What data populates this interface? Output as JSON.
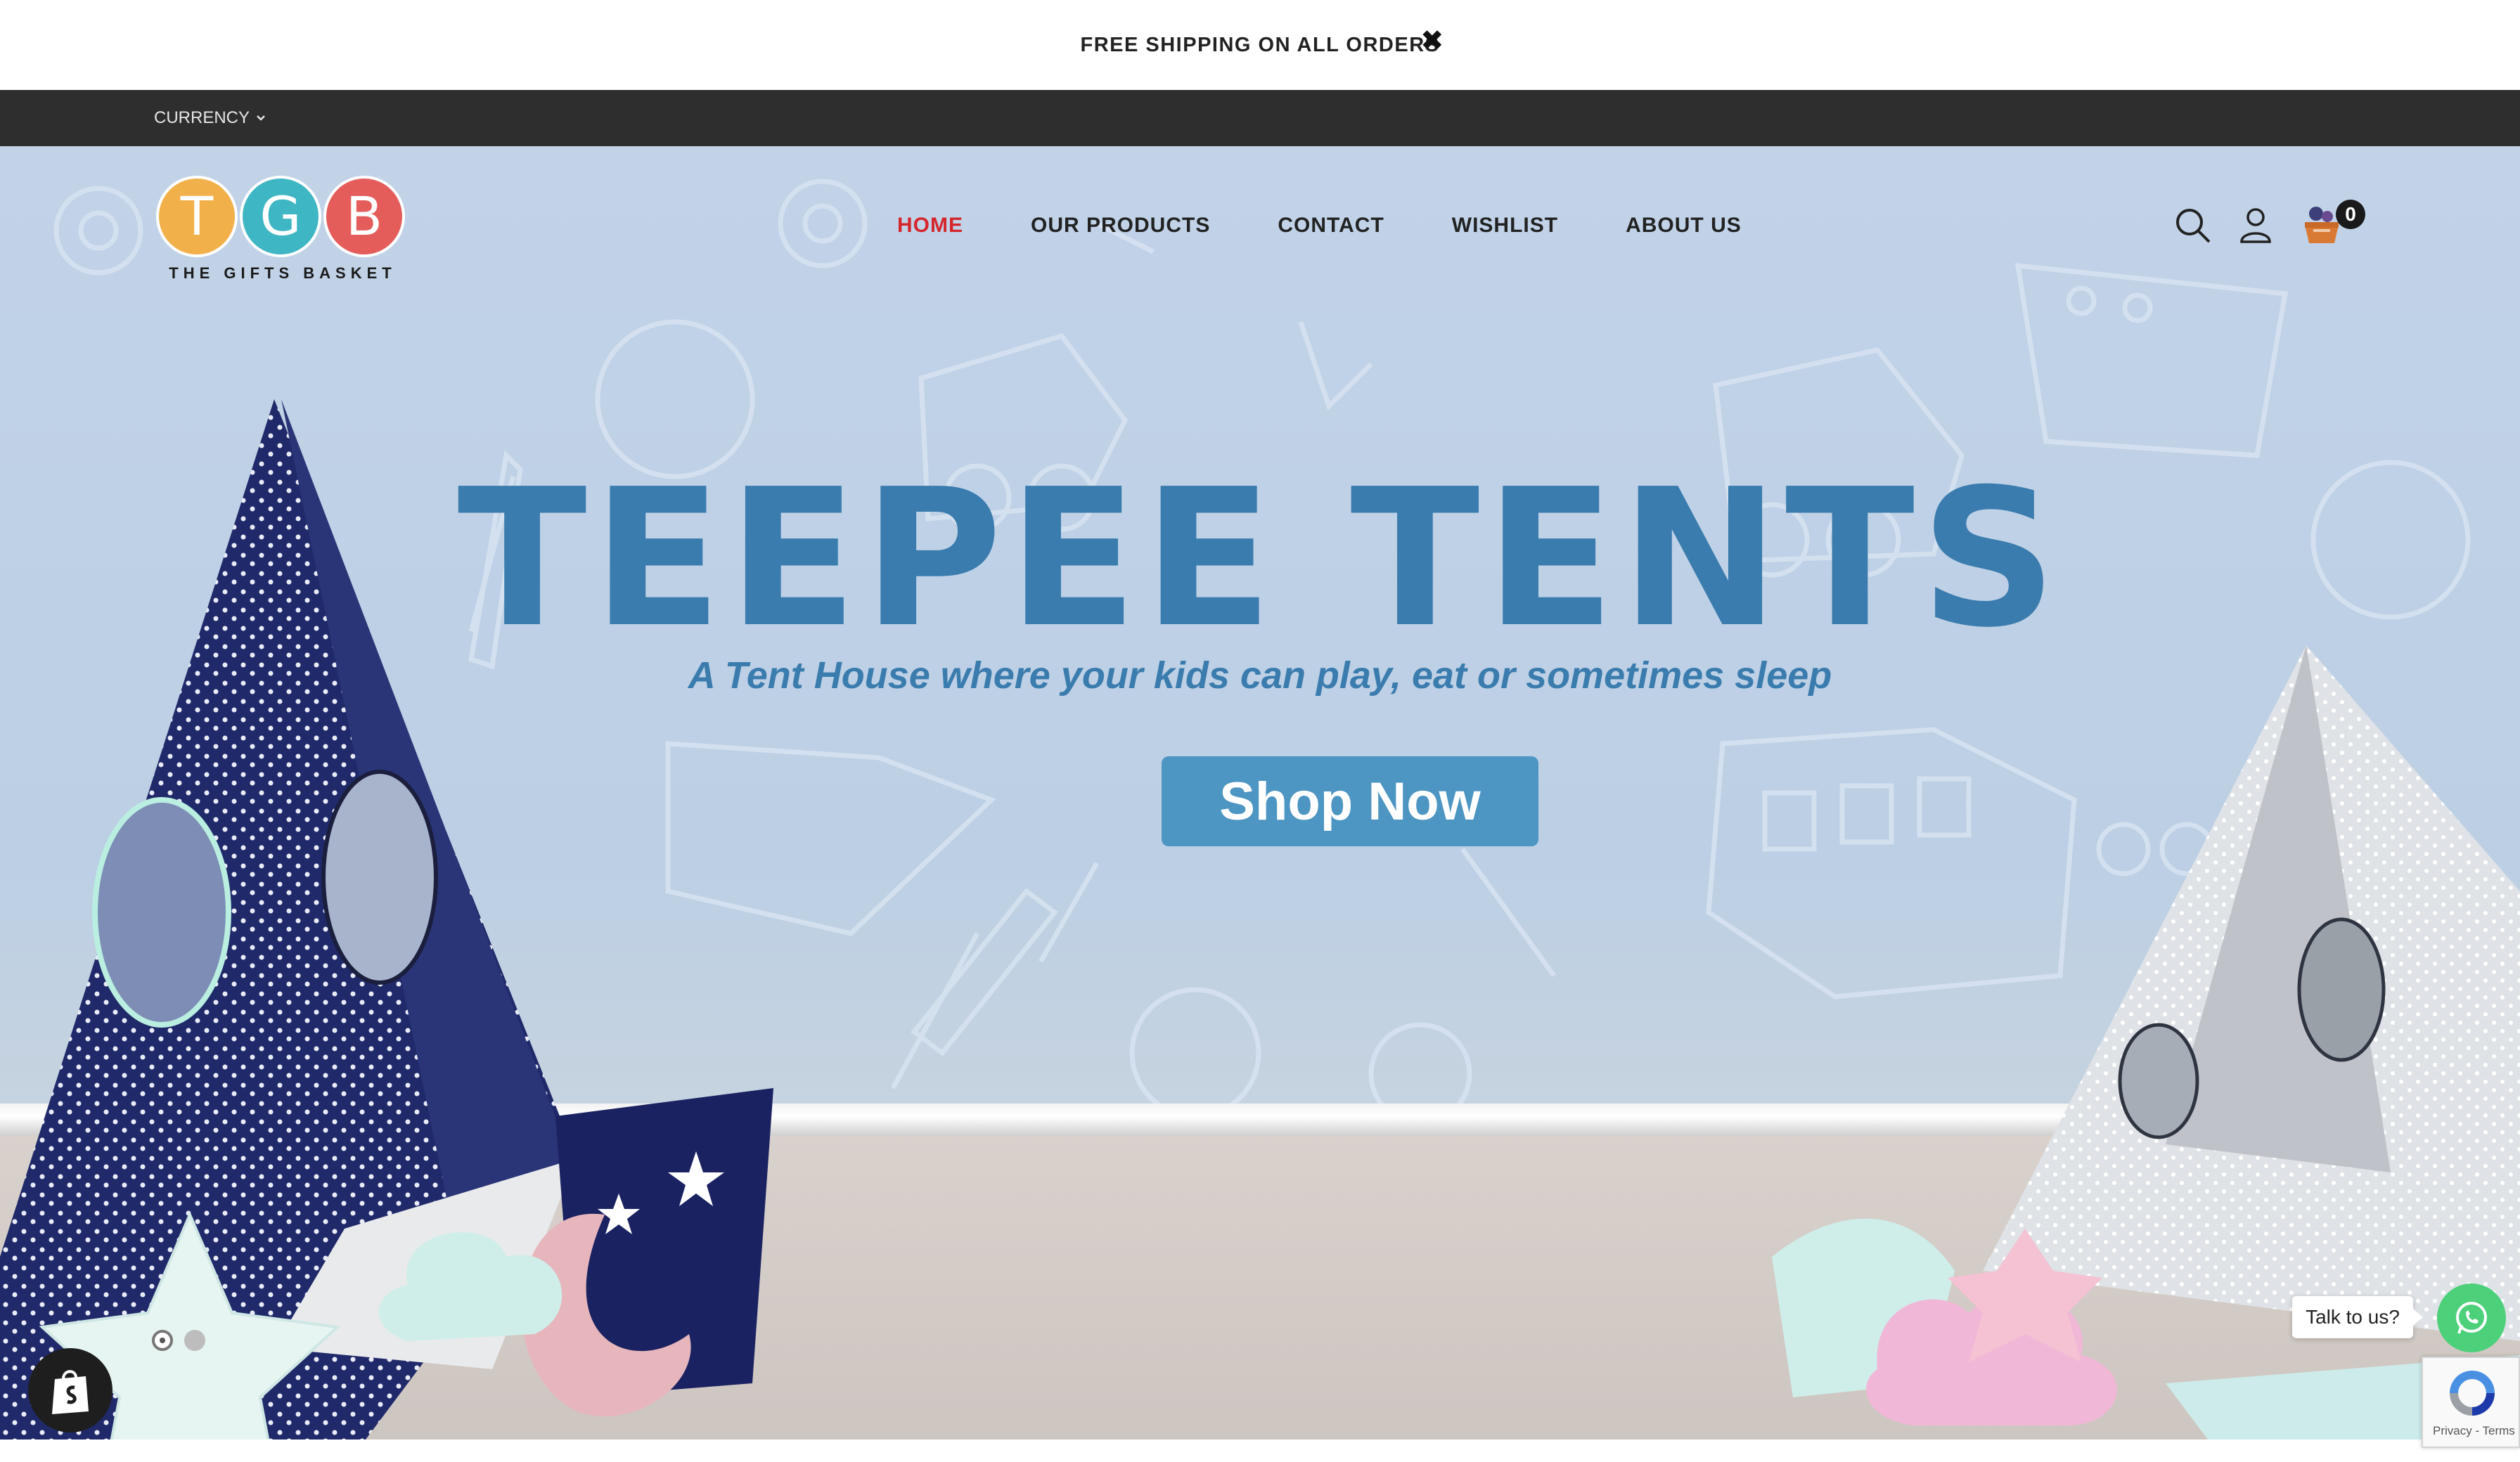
{
  "announcement": {
    "text": "FREE SHIPPING ON ALL ORDERS",
    "close_glyph": "✖"
  },
  "topbar": {
    "currency_label": "CURRENCY"
  },
  "logo": {
    "letters": [
      "T",
      "G",
      "B"
    ],
    "tagline": "THE GIFTS BASKET",
    "letter_colors": [
      "#f2b04a",
      "#3fb6c4",
      "#e45d5b"
    ]
  },
  "nav": {
    "items": [
      {
        "label": "HOME",
        "active": true
      },
      {
        "label": "OUR PRODUCTS",
        "active": false
      },
      {
        "label": "CONTACT",
        "active": false
      },
      {
        "label": "WISHLIST",
        "active": false
      },
      {
        "label": "ABOUT US",
        "active": false
      }
    ]
  },
  "header_icons": {
    "search": "search-icon",
    "account": "user-icon",
    "cart": "cart-icon",
    "cart_count": "0"
  },
  "hero": {
    "headline": "TEEPEE TENTS",
    "subheadline": "A Tent House where your kids can play, eat or sometimes sleep",
    "cta_label": "Shop Now",
    "slides": 2,
    "active_slide": 1
  },
  "chat": {
    "label": "Talk to us?"
  },
  "recaptcha": {
    "footer": "Privacy - Terms"
  },
  "colors": {
    "accent_red": "#d4262b",
    "headline_blue": "#3a7cae",
    "cta_blue": "#4d95c2",
    "whatsapp_green": "#4dd07a",
    "topbar": "#2e2e2e"
  }
}
